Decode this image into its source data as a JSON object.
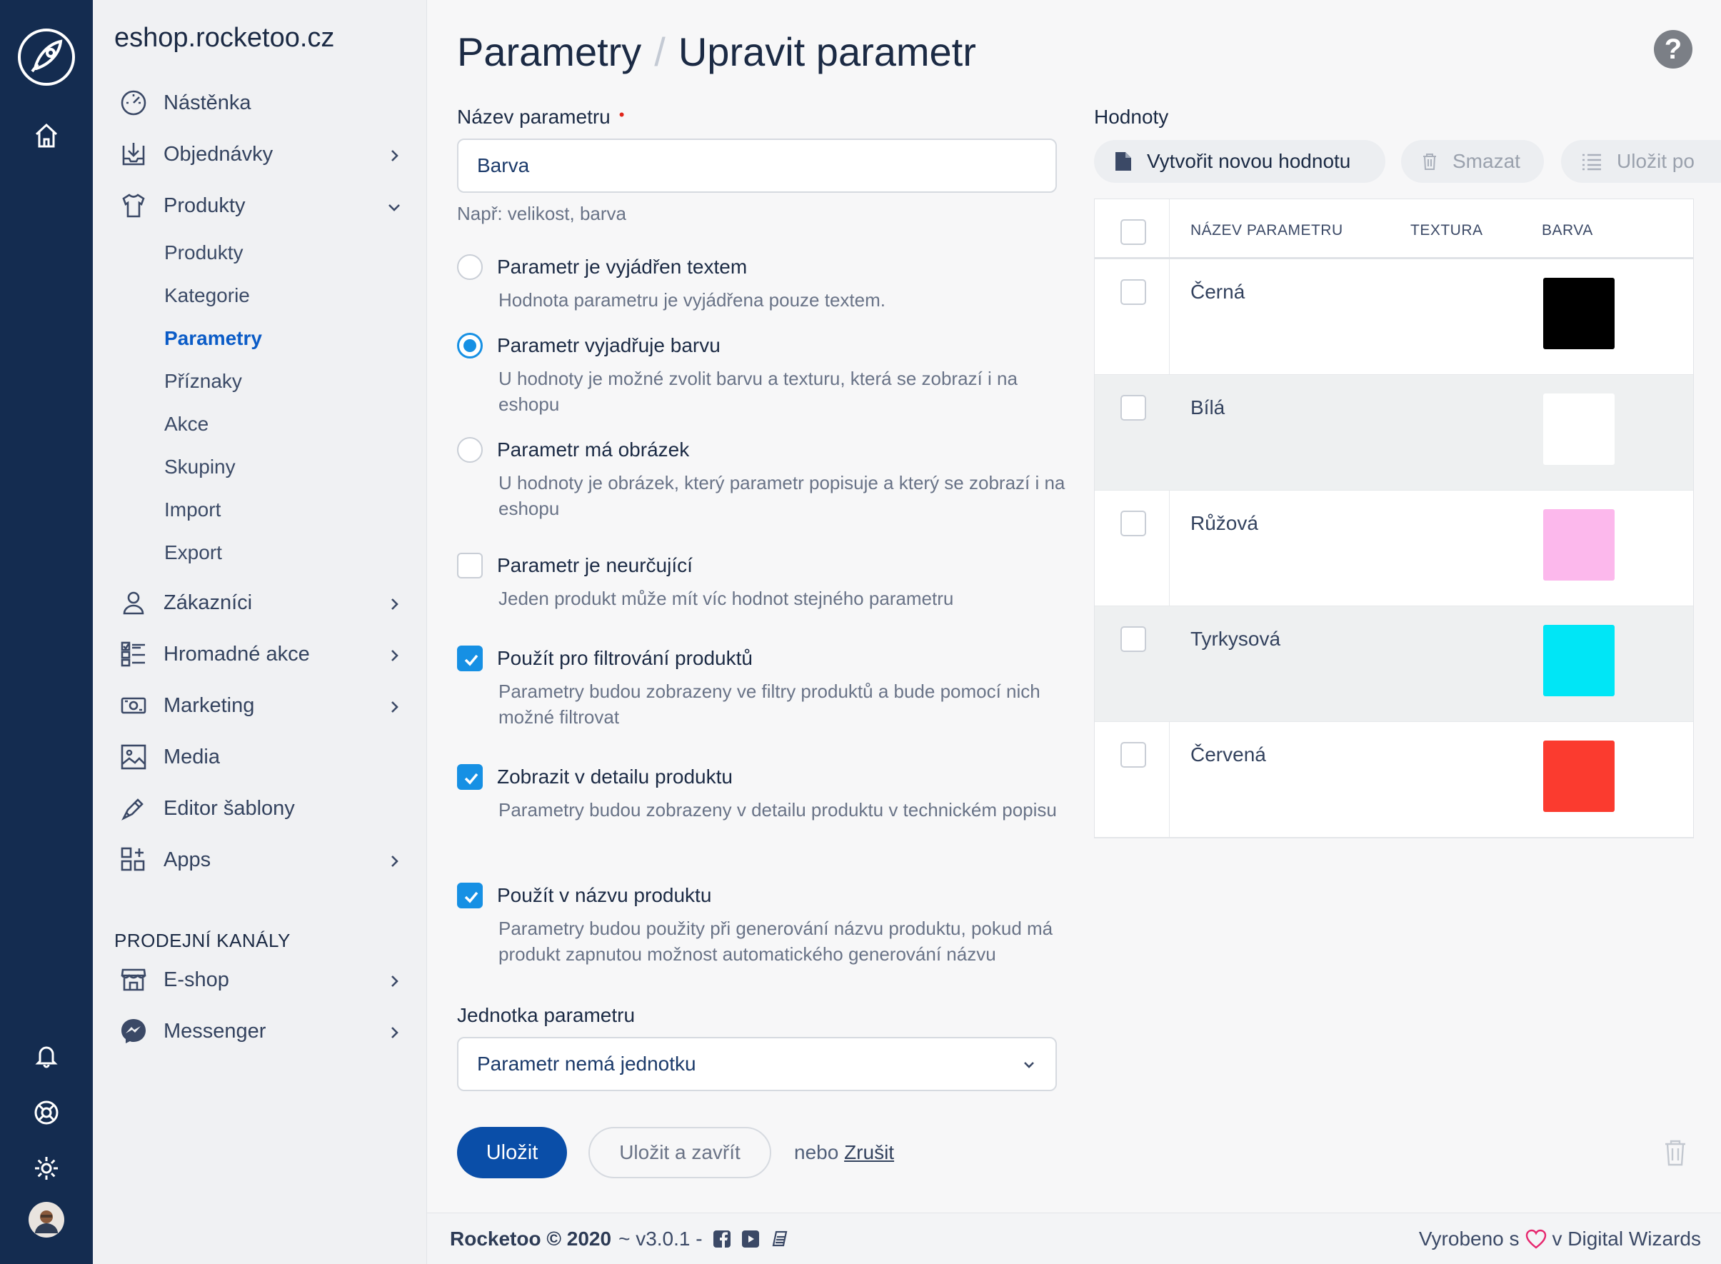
{
  "site": {
    "name": "eshop.rocketoo.cz"
  },
  "nav": {
    "dashboard": "Nástěnka",
    "orders": "Objednávky",
    "products": "Produkty",
    "products_sub": [
      "Produkty",
      "Kategorie",
      "Parametry",
      "Příznaky",
      "Akce",
      "Skupiny",
      "Import",
      "Export"
    ],
    "customers": "Zákazníci",
    "bulk": "Hromadné akce",
    "marketing": "Marketing",
    "media": "Media",
    "template_editor": "Editor šablony",
    "apps": "Apps",
    "sales_channels_label": "PRODEJNÍ KANÁLY",
    "eshop": "E-shop",
    "messenger": "Messenger"
  },
  "header": {
    "crumb_parent": "Parametry",
    "crumb_sep": "/",
    "crumb_current": "Upravit parametr",
    "help": "?"
  },
  "form": {
    "name_label": "Název parametru",
    "required_mark": "•",
    "name_value": "Barva",
    "name_hint": "Např: velikost, barva",
    "options": [
      {
        "type": "radio",
        "checked": false,
        "title": "Parametr je vyjádřen textem",
        "desc": "Hodnota parametru je vyjádřena pouze textem."
      },
      {
        "type": "radio",
        "checked": true,
        "title": "Parametr vyjadřuje barvu",
        "desc": "U hodnoty je možné zvolit barvu a texturu, která se zobrazí i na eshopu"
      },
      {
        "type": "radio",
        "checked": false,
        "title": "Parametr má obrázek",
        "desc": "U hodnoty je obrázek, který parametr popisuje a který se zobrazí i na eshopu"
      },
      {
        "type": "checkbox",
        "checked": false,
        "title": "Parametr je neurčující",
        "desc": "Jeden produkt může mít víc hodnot stejného parametru"
      },
      {
        "type": "checkbox",
        "checked": true,
        "title": "Použít pro filtrování produktů",
        "desc": "Parametry budou zobrazeny ve filtry produktů a bude pomocí nich možné filtrovat"
      },
      {
        "type": "checkbox",
        "checked": true,
        "title": "Zobrazit v detailu produktu",
        "desc": "Parametry budou zobrazeny v detailu produktu v technickém popisu"
      },
      {
        "type": "checkbox",
        "checked": true,
        "title": "Použít v názvu produktu",
        "desc": "Parametry budou použity při generování názvu produktu, pokud má produkt zapnutou možnost automatického generování názvu"
      }
    ],
    "unit_label": "Jednotka parametru",
    "unit_value": "Parametr nemá jednotku",
    "save": "Uložit",
    "save_close": "Uložit a zavřít",
    "or": "nebo",
    "cancel": "Zrušit"
  },
  "values": {
    "label": "Hodnoty",
    "create": "Vytvořit novou hodnotu",
    "delete": "Smazat",
    "save_order": "Uložit po",
    "columns": [
      "NÁZEV PARAMETRU",
      "TEXTURA",
      "BARVA"
    ],
    "rows": [
      {
        "name": "Černá",
        "color": "#000000"
      },
      {
        "name": "Bílá",
        "color": "#ffffff"
      },
      {
        "name": "Růžová",
        "color": "#fcb8ec"
      },
      {
        "name": "Tyrkysová",
        "color": "#00e6f6"
      },
      {
        "name": "Červená",
        "color": "#fb3b2f"
      }
    ]
  },
  "footer": {
    "brand": "Rocketoo © 2020",
    "version": "~ v3.0.1 -",
    "made_with": "Vyrobeno s",
    "made_by": "v Digital Wizards"
  },
  "colors": {
    "rail": "#142c50",
    "accent": "#1690e4",
    "primary_button": "#0a4ea8",
    "active_nav": "#0b5cc7"
  }
}
